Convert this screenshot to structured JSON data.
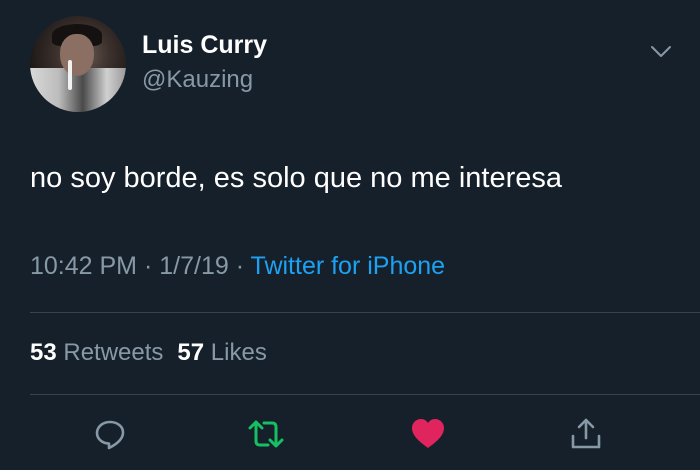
{
  "tweet": {
    "author_name": "Luis Curry",
    "author_handle": "@Kauzing",
    "text": "no soy borde, es solo que no me interesa",
    "time": "10:42 PM",
    "date": "1/7/19",
    "separator": "·",
    "source": "Twitter for iPhone"
  },
  "stats": {
    "retweets_count": "53",
    "retweets_label": "Retweets",
    "likes_count": "57",
    "likes_label": "Likes"
  },
  "actions": {
    "reply_icon": "reply-bubble-icon",
    "retweet_icon": "retweet-icon",
    "like_icon": "heart-icon",
    "share_icon": "share-icon"
  },
  "colors": {
    "background": "#15202b",
    "secondary_text": "#8899a6",
    "link": "#1da1f2",
    "retweet_active": "#17bf63",
    "like_active": "#e0245e"
  }
}
